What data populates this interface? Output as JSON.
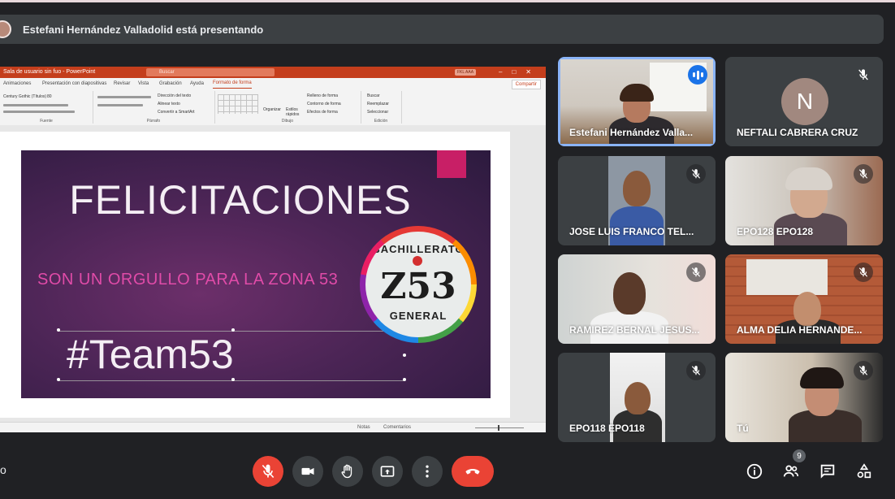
{
  "presenting_banner": {
    "text": "Estefani Hernández Valladolid está presentando"
  },
  "powerpoint": {
    "file_title": "Sala de usuario sin fuo - PowerPoint",
    "search_placeholder": "Buscar",
    "account": "FKL AAA",
    "tabs": [
      "Animaciones",
      "Presentación con diapositivas",
      "Revisar",
      "Vista",
      "Grabación",
      "Ayuda",
      "Formato de forma"
    ],
    "active_tab": "Formato de forma",
    "share_label": "Compartir",
    "ribbon_groups": [
      "Fuente",
      "Párrafo",
      "Dibujo",
      "Edición"
    ],
    "ribbon_items": {
      "font": "Century Gothic (Títulos)",
      "font_size": "80",
      "dir_text": "Dirección del texto",
      "align_text": "Alinear texto",
      "smartart": "Convertir a SmartArt",
      "arrange": "Organizar",
      "quick_styles": "Estilos rápidos",
      "fill": "Relleno de forma",
      "outline": "Contorno de forma",
      "effects": "Efectos de forma",
      "find": "Buscar",
      "replace": "Reemplazar",
      "select": "Seleccionar"
    },
    "status": {
      "notes": "Notas",
      "comments": "Comentarios"
    }
  },
  "slide": {
    "title": "FELICITACIONES",
    "subtitle": "SON UN ORGULLO PARA LA ZONA 53",
    "hashtag": "#Team53",
    "logo": {
      "top": "BACHILLERATO",
      "center": "Z53",
      "bottom": "GENERAL"
    }
  },
  "participants": [
    {
      "name": "Estefani Hernández Valla...",
      "speaking": true
    },
    {
      "name": "NEFTALI CABRERA CRUZ",
      "initial": "N",
      "avatar_color": "#a1887f",
      "muted": true
    },
    {
      "name": "JOSE LUIS FRANCO TEL...",
      "muted": true
    },
    {
      "name": "EPO128 EPO128",
      "muted": true
    },
    {
      "name": "RAMIREZ BERNAL JESUS...",
      "muted": true
    },
    {
      "name": "ALMA DELIA HERNANDE...",
      "muted": true
    },
    {
      "name": "EPO118 EPO118",
      "muted": true
    },
    {
      "name": "Tú",
      "muted": true
    }
  ],
  "controls": {
    "meeting_code_fragment": "o",
    "participant_count": "9",
    "buttons": [
      "mic-off",
      "camera",
      "raise-hand",
      "present-now",
      "more-options",
      "leave-call"
    ],
    "right_buttons": [
      "meeting-details",
      "people",
      "chat",
      "activities"
    ]
  },
  "colors": {
    "accent": "#1a73e8",
    "danger": "#ea4335",
    "powerpoint": "#c43e1c",
    "slide_pink": "#c81f66"
  }
}
